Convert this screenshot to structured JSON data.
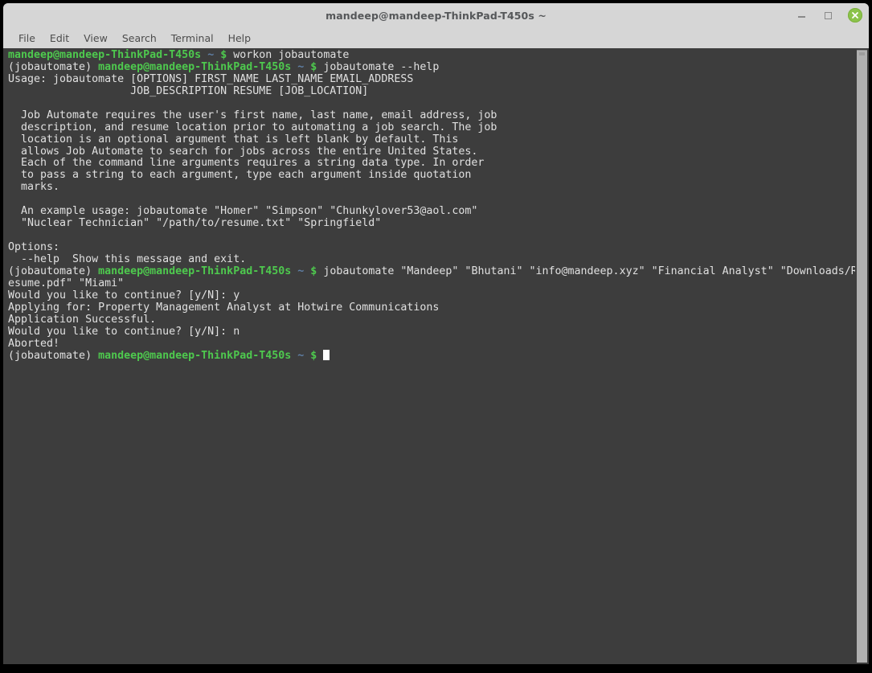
{
  "window": {
    "title": "mandeep@mandeep-ThinkPad-T450s ~",
    "controls": {
      "minimize_label": "Minimize",
      "maximize_label": "Restore",
      "close_label": "Close"
    },
    "colors": {
      "titlebar_bg": "#d6d6d6",
      "terminal_bg": "#3d3d3d",
      "terminal_fg": "#d9d9d9",
      "prompt_green": "#4ec94e",
      "prompt_tilde": "#5f7fa5",
      "close_button": "#8bc34a",
      "scrollbar_thumb": "#b0b0b0",
      "page_bg": "#000000"
    }
  },
  "menubar": {
    "items": [
      {
        "label": "File"
      },
      {
        "label": "Edit"
      },
      {
        "label": "View"
      },
      {
        "label": "Search"
      },
      {
        "label": "Terminal"
      },
      {
        "label": "Help"
      }
    ]
  },
  "terminal": {
    "prompt": {
      "venv": "(jobautomate)",
      "user_host": "mandeep@mandeep-ThinkPad-T450s",
      "path": "~",
      "symbol": "$"
    },
    "lines": [
      {
        "type": "prompt_plain",
        "command": " workon jobautomate"
      },
      {
        "type": "prompt_venv",
        "command": " jobautomate --help"
      },
      {
        "type": "out",
        "text": "Usage: jobautomate [OPTIONS] FIRST_NAME LAST_NAME EMAIL_ADDRESS"
      },
      {
        "type": "out",
        "text": "                   JOB_DESCRIPTION RESUME [JOB_LOCATION]"
      },
      {
        "type": "out",
        "text": ""
      },
      {
        "type": "out",
        "text": "  Job Automate requires the user's first name, last name, email address, job"
      },
      {
        "type": "out",
        "text": "  description, and resume location prior to automating a job search. The job"
      },
      {
        "type": "out",
        "text": "  location is an optional argument that is left blank by default. This"
      },
      {
        "type": "out",
        "text": "  allows Job Automate to search for jobs across the entire United States."
      },
      {
        "type": "out",
        "text": "  Each of the command line arguments requires a string data type. In order"
      },
      {
        "type": "out",
        "text": "  to pass a string to each argument, type each argument inside quotation"
      },
      {
        "type": "out",
        "text": "  marks."
      },
      {
        "type": "out",
        "text": ""
      },
      {
        "type": "out",
        "text": "  An example usage: jobautomate \"Homer\" \"Simpson\" \"Chunkylover53@aol.com\""
      },
      {
        "type": "out",
        "text": "  \"Nuclear Technician\" \"/path/to/resume.txt\" \"Springfield\""
      },
      {
        "type": "out",
        "text": ""
      },
      {
        "type": "out",
        "text": "Options:"
      },
      {
        "type": "out",
        "text": "  --help  Show this message and exit."
      },
      {
        "type": "prompt_venv",
        "command": " jobautomate \"Mandeep\" \"Bhutani\" \"info@mandeep.xyz\" \"Financial Analyst\" \"Downloads/R"
      },
      {
        "type": "out",
        "text": "esume.pdf\" \"Miami\""
      },
      {
        "type": "out",
        "text": "Would you like to continue? [y/N]: y"
      },
      {
        "type": "out",
        "text": "Applying for: Property Management Analyst at Hotwire Communications"
      },
      {
        "type": "out",
        "text": "Application Successful."
      },
      {
        "type": "out",
        "text": "Would you like to continue? [y/N]: n"
      },
      {
        "type": "out",
        "text": "Aborted!"
      },
      {
        "type": "prompt_venv_cursor",
        "command": " "
      }
    ]
  }
}
